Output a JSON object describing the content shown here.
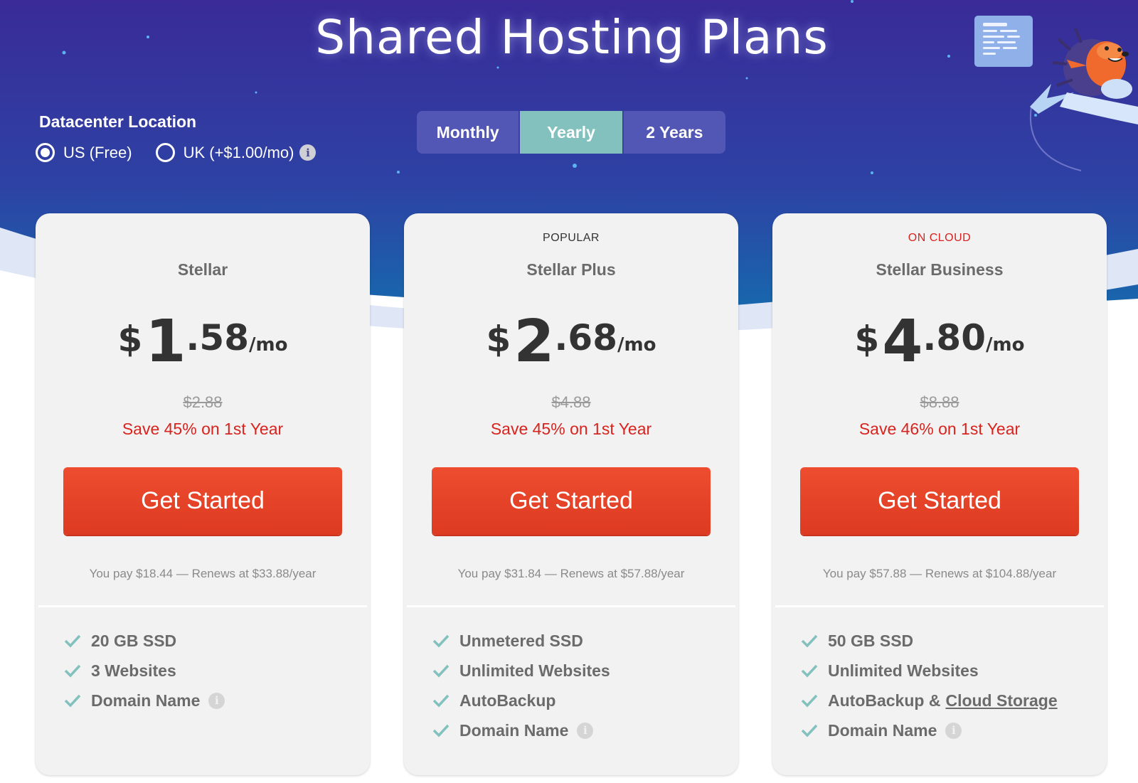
{
  "page_title": "Shared Hosting Plans",
  "datacenter": {
    "title": "Datacenter Location",
    "options": [
      {
        "label": "US (Free)",
        "selected": true
      },
      {
        "label": "UK (+$1.00/mo)",
        "selected": false
      }
    ]
  },
  "billing_periods": [
    {
      "label": "Monthly",
      "active": false
    },
    {
      "label": "Yearly",
      "active": true
    },
    {
      "label": "2 Years",
      "active": false
    }
  ],
  "colors": {
    "hero_top": "#3a2d9a",
    "hero_bottom": "#1a5aa8",
    "accent_teal": "#82c1bd",
    "cta": "#e8432a",
    "save_red": "#d9231e",
    "on_cloud_red": "#d9231e"
  },
  "plans": [
    {
      "badge": "",
      "name": "Stellar",
      "currency": "$",
      "price_whole": "1",
      "price_cents": ".58",
      "per": "/mo",
      "old_price": "$2.88",
      "save": "Save 45% on 1st Year",
      "cta": "Get Started",
      "pay_note": "You pay $18.44 — Renews at $33.88/year",
      "features": [
        {
          "text": "20 GB SSD"
        },
        {
          "text": "3 Websites"
        },
        {
          "text": "Domain Name",
          "info": "i"
        }
      ]
    },
    {
      "badge": "POPULAR",
      "name": "Stellar Plus",
      "currency": "$",
      "price_whole": "2",
      "price_cents": ".68",
      "per": "/mo",
      "old_price": "$4.88",
      "save": "Save 45% on 1st Year",
      "cta": "Get Started",
      "pay_note": "You pay $31.84 — Renews at $57.88/year",
      "features": [
        {
          "text": "Unmetered SSD"
        },
        {
          "text": "Unlimited Websites"
        },
        {
          "text": "AutoBackup"
        },
        {
          "text": "Domain Name",
          "info": "i"
        }
      ]
    },
    {
      "badge": "ON CLOUD",
      "name": "Stellar Business",
      "currency": "$",
      "price_whole": "4",
      "price_cents": ".80",
      "per": "/mo",
      "old_price": "$8.88",
      "save": "Save 46% on 1st Year",
      "cta": "Get Started",
      "pay_note": "You pay $57.88 — Renews at $104.88/year",
      "features": [
        {
          "text": "50 GB SSD"
        },
        {
          "text": "Unlimited Websites"
        },
        {
          "text": "AutoBackup &",
          "link": "Cloud Storage"
        },
        {
          "text": "Domain Name",
          "info": "i"
        }
      ]
    }
  ],
  "info_glyph": "i",
  "icons": [
    "info-icon",
    "check-icon",
    "chat-window-icon",
    "hedgehog-mascot-icon"
  ]
}
